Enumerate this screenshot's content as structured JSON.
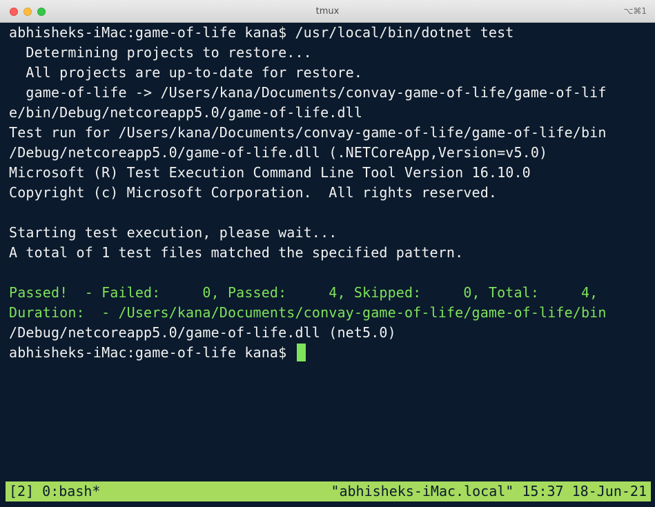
{
  "window": {
    "title": "tmux",
    "shortcut": "⌥⌘1"
  },
  "terminal": {
    "lines": [
      {
        "text": "abhisheks-iMac:game-of-life kana$ /usr/local/bin/dotnet test",
        "color": "white"
      },
      {
        "text": "  Determining projects to restore...",
        "color": "white"
      },
      {
        "text": "  All projects are up-to-date for restore.",
        "color": "white"
      },
      {
        "text": "  game-of-life -> /Users/kana/Documents/convay-game-of-life/game-of-lif",
        "color": "white"
      },
      {
        "text": "e/bin/Debug/netcoreapp5.0/game-of-life.dll",
        "color": "white"
      },
      {
        "text": "Test run for /Users/kana/Documents/convay-game-of-life/game-of-life/bin",
        "color": "white"
      },
      {
        "text": "/Debug/netcoreapp5.0/game-of-life.dll (.NETCoreApp,Version=v5.0)",
        "color": "white"
      },
      {
        "text": "Microsoft (R) Test Execution Command Line Tool Version 16.10.0",
        "color": "white"
      },
      {
        "text": "Copyright (c) Microsoft Corporation.  All rights reserved.",
        "color": "white"
      },
      {
        "text": "",
        "color": "white"
      },
      {
        "text": "Starting test execution, please wait...",
        "color": "white"
      },
      {
        "text": "A total of 1 test files matched the specified pattern.",
        "color": "white"
      },
      {
        "text": "",
        "color": "white"
      },
      {
        "text": "Passed!  - Failed:     0, Passed:     4, Skipped:     0, Total:     4,",
        "color": "green"
      },
      {
        "text": "Duration:  - /Users/kana/Documents/convay-game-of-life/game-of-life/bin",
        "color": "green"
      },
      {
        "text": "/Debug/netcoreapp5.0/game-of-life.dll (net5.0)",
        "color": "white"
      }
    ],
    "prompt": "abhisheks-iMac:game-of-life kana$ "
  },
  "statusbar": {
    "left": "[2] 0:bash*",
    "right": "\"abhisheks-iMac.local\" 15:37 18-Jun-21"
  },
  "colors": {
    "background": "#0b1a2c",
    "text": "#f2f2f2",
    "accent_green": "#7ee25b",
    "statusbar_bg": "#a6db5e"
  }
}
